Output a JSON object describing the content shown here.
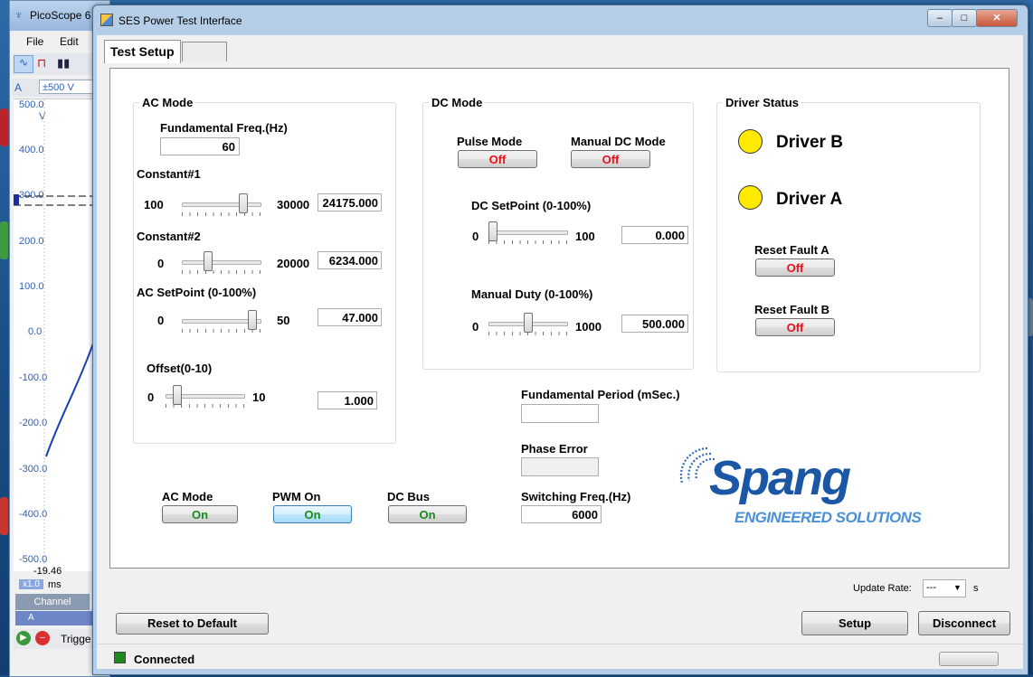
{
  "background_app": {
    "title": "PicoScope 6",
    "menu": [
      "File",
      "Edit"
    ],
    "range": "±500 V",
    "y_axis": [
      "500.0",
      "V",
      "400.0",
      "300.0",
      "200.0",
      "100.0",
      "0.0",
      "-100.0",
      "-200.0",
      "-300.0",
      "-400.0",
      "-500.0"
    ],
    "time_value": "-19.46",
    "scale": "x1.0",
    "time_unit": "ms",
    "channel_header": "Channel",
    "channel_a": "A",
    "trigger": "Trigge"
  },
  "window": {
    "title": "SES Power Test Interface",
    "minimize": "–",
    "maximize": "□",
    "close": "✕"
  },
  "tabs": [
    "Test Setup",
    ""
  ],
  "ac_mode_group": {
    "title": "AC Mode",
    "fund_freq_label": "Fundamental Freq.(Hz)",
    "fund_freq_value": "60",
    "constant1": {
      "label": "Constant#1",
      "min": "100",
      "max": "30000",
      "value": "24175.000",
      "level": 0.805
    },
    "constant2": {
      "label": "Constant#2",
      "min": "0",
      "max": "20000",
      "value": "6234.000",
      "level": 0.312
    },
    "ac_setpoint": {
      "label": "AC SetPoint (0-100%)",
      "min": "0",
      "max": "50",
      "value": "47.000",
      "level": 0.94
    },
    "offset": {
      "label": "Offset(0-10)",
      "min": "0",
      "max": "10",
      "value": "1.000",
      "level": 0.1
    }
  },
  "dc_mode_group": {
    "title": "DC Mode",
    "pulse_mode_label": "Pulse Mode",
    "pulse_mode_state": "Off",
    "manual_dc_label": "Manual DC Mode",
    "manual_dc_state": "Off",
    "dc_setpoint": {
      "label": "DC SetPoint (0-100%)",
      "min": "0",
      "max": "100",
      "value": "0.000",
      "level": 0.0
    },
    "manual_duty": {
      "label": "Manual Duty (0-100%)",
      "min": "0",
      "max": "1000",
      "value": "500.000",
      "level": 0.5
    }
  },
  "driver_status_group": {
    "title": "Driver Status",
    "driver_b": "Driver B",
    "driver_a": "Driver A",
    "led_color": "#ffea00",
    "reset_fault_a_label": "Reset Fault A",
    "reset_fault_a_state": "Off",
    "reset_fault_b_label": "Reset Fault B",
    "reset_fault_b_state": "Off"
  },
  "status_fields": {
    "fund_period_label": "Fundamental Period (mSec.)",
    "fund_period_value": "",
    "phase_error_label": "Phase Error",
    "phase_error_value": "",
    "switching_freq_label": "Switching Freq.(Hz)",
    "switching_freq_value": "6000"
  },
  "toggles": {
    "ac_mode_label": "AC Mode",
    "ac_mode_state": "On",
    "pwm_label": "PWM On",
    "pwm_state": "On",
    "dc_bus_label": "DC Bus",
    "dc_bus_state": "On"
  },
  "logo": {
    "name": "Spang",
    "tagline": "ENGINEERED SOLUTIONS",
    "color": "#1b57a5",
    "tagline_color": "#4a90d9"
  },
  "update_rate": {
    "label": "Update Rate:",
    "value": "---",
    "unit": "s"
  },
  "buttons": {
    "reset_default": "Reset to Default",
    "setup": "Setup",
    "disconnect": "Disconnect"
  },
  "status_bar": {
    "text": "Connected",
    "indicator_color": "#1c8a1c"
  },
  "colors": {
    "off": "#e8121c",
    "on": "#188a1b"
  }
}
